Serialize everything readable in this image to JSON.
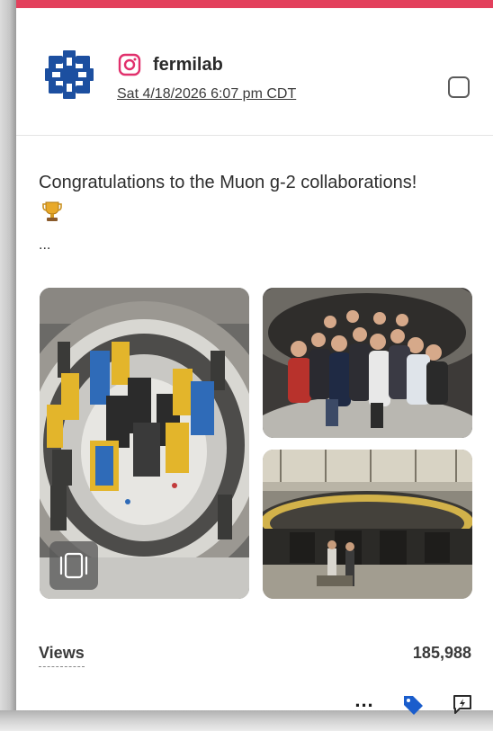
{
  "post": {
    "platform_icon": "instagram-icon",
    "account_name": "fermilab",
    "date": "Sat 4/18/2026 6:07 pm CDT",
    "caption": "Congratulations to the Muon g-2 collaborations!",
    "caption_emoji": "trophy",
    "caption_more": "...",
    "media": [
      {
        "name": "muon-g-2-ring-photo",
        "carousel": true
      },
      {
        "name": "group-photo"
      },
      {
        "name": "experiment-hall-photo"
      }
    ]
  },
  "metrics": {
    "views_label": "Views",
    "views_value": "185,988"
  },
  "actions": {
    "more_label": "...",
    "tag_icon": "tag-icon",
    "reply_icon": "reply-icon"
  },
  "colors": {
    "accent": "#e3405c",
    "instagram": "#e1306c",
    "tag": "#1a5dcc",
    "text": "#2b2b2b"
  }
}
